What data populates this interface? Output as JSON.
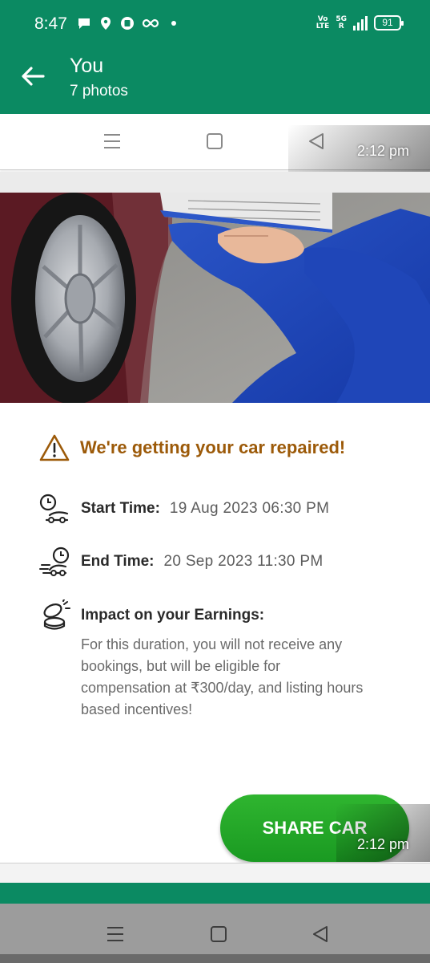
{
  "status_bar": {
    "time": "8:47",
    "network_top": "Vo",
    "network_bottom": "LTE",
    "signal_top": "5G",
    "signal_bottom": "R",
    "battery": "91"
  },
  "viewer": {
    "title": "You",
    "subtitle": "7 photos"
  },
  "photo": {
    "timestamp_top": "2:12 pm",
    "timestamp_bottom": "2:12 pm",
    "warning_title": "We're getting your car repaired!",
    "start_label": "Start Time:",
    "start_value": "19 Aug 2023 06:30 PM",
    "end_label": "End Time:",
    "end_value": "20 Sep 2023 11:30 PM",
    "impact_title": "Impact on your Earnings:",
    "impact_text": "For this duration, you will not receive any bookings, but will be eligible for compensation at ₹300/day, and listing hours based incentives!",
    "share_label": "SHARE CAR"
  },
  "colors": {
    "header_green": "#0b8a62",
    "warning_brown": "#9c5a09",
    "button_green": "#22a529"
  }
}
